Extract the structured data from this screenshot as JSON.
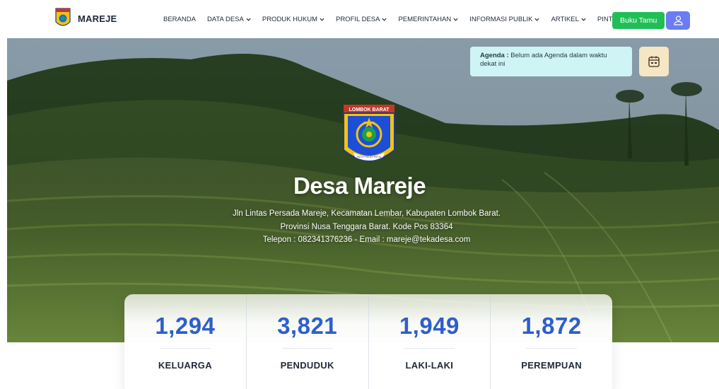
{
  "header": {
    "brand_name": "MAREJE",
    "menu": [
      {
        "label": "BERANDA",
        "dropdown": false
      },
      {
        "label": "DATA DESA",
        "dropdown": true
      },
      {
        "label": "PRODUK HUKUM",
        "dropdown": true
      },
      {
        "label": "PROFIL DESA",
        "dropdown": true
      },
      {
        "label": "PEMERINTAHAN",
        "dropdown": true
      },
      {
        "label": "INFORMASI PUBLIK",
        "dropdown": true
      },
      {
        "label": "ARTIKEL",
        "dropdown": true
      },
      {
        "label": "PINTU DESA",
        "dropdown": false
      }
    ],
    "guestbook_button": "Buku Tamu",
    "user_icon": "user-icon",
    "accent_green": "#1fbf55",
    "accent_purple": "#6b7bf3"
  },
  "agenda": {
    "label": "Agenda :",
    "text": "Belum ada Agenda dalam waktu dekat ini",
    "icon": "calendar-icon"
  },
  "hero": {
    "emblem_banner": "LOMBOK BARAT",
    "emblem_motto": "PATUT PATUH PATJU",
    "title": "Desa Mareje",
    "address_line1": "Jln Lintas Persada Mareje, Kecamatan Lembar, Kabupaten Lombok Barat.",
    "address_line2": "Provinsi Nusa Tenggara Barat. Kode Pos 83364",
    "address_line3": "Telepon : 082341376236 - Email : mareje@tekadesa.com"
  },
  "stats": [
    {
      "value": "1,294",
      "label": "KELUARGA"
    },
    {
      "value": "3,821",
      "label": "PENDUDUK"
    },
    {
      "value": "1,949",
      "label": "LAKI-LAKI"
    },
    {
      "value": "1,872",
      "label": "PEREMPUAN"
    }
  ],
  "colors": {
    "stat_value": "#2e5fc9",
    "agenda_bg": "#cff4f5",
    "agenda_icon_bg": "#f5e6c4"
  }
}
